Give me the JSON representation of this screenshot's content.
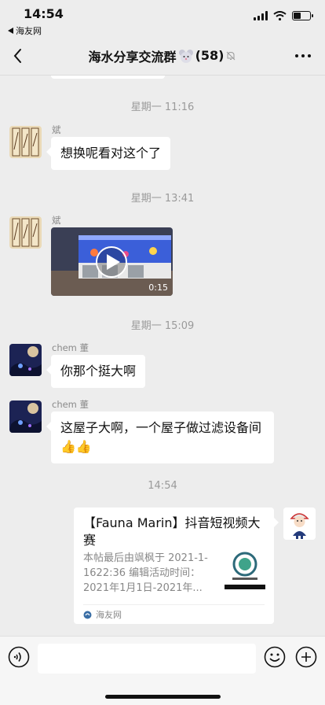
{
  "status_bar": {
    "time": "14:54",
    "back_app": "海友网"
  },
  "nav": {
    "title": "海水分享交流群",
    "count": "(58)"
  },
  "messages": {
    "ts1": "星期一 11:16",
    "m1_sender": "斌",
    "m1_text": "想换呢看对这个了",
    "ts2": "星期一 13:41",
    "m2_sender": "斌",
    "m2_duration": "0:15",
    "ts3": "星期一 15:09",
    "m3_sender": "chem 董",
    "m3_text": "你那个挺大啊",
    "m4_sender": "chem 董",
    "m4_text": "这屋子大啊，一个屋子做过滤设备间👍👍",
    "ts4": "14:54"
  },
  "card": {
    "title": "【Fauna Marin】抖音短视频大赛",
    "desc": "本帖最后由飒枫于 2021-1-1622:36 编辑活动时间：2021年1月1日-2021年...",
    "source": "海友网"
  }
}
